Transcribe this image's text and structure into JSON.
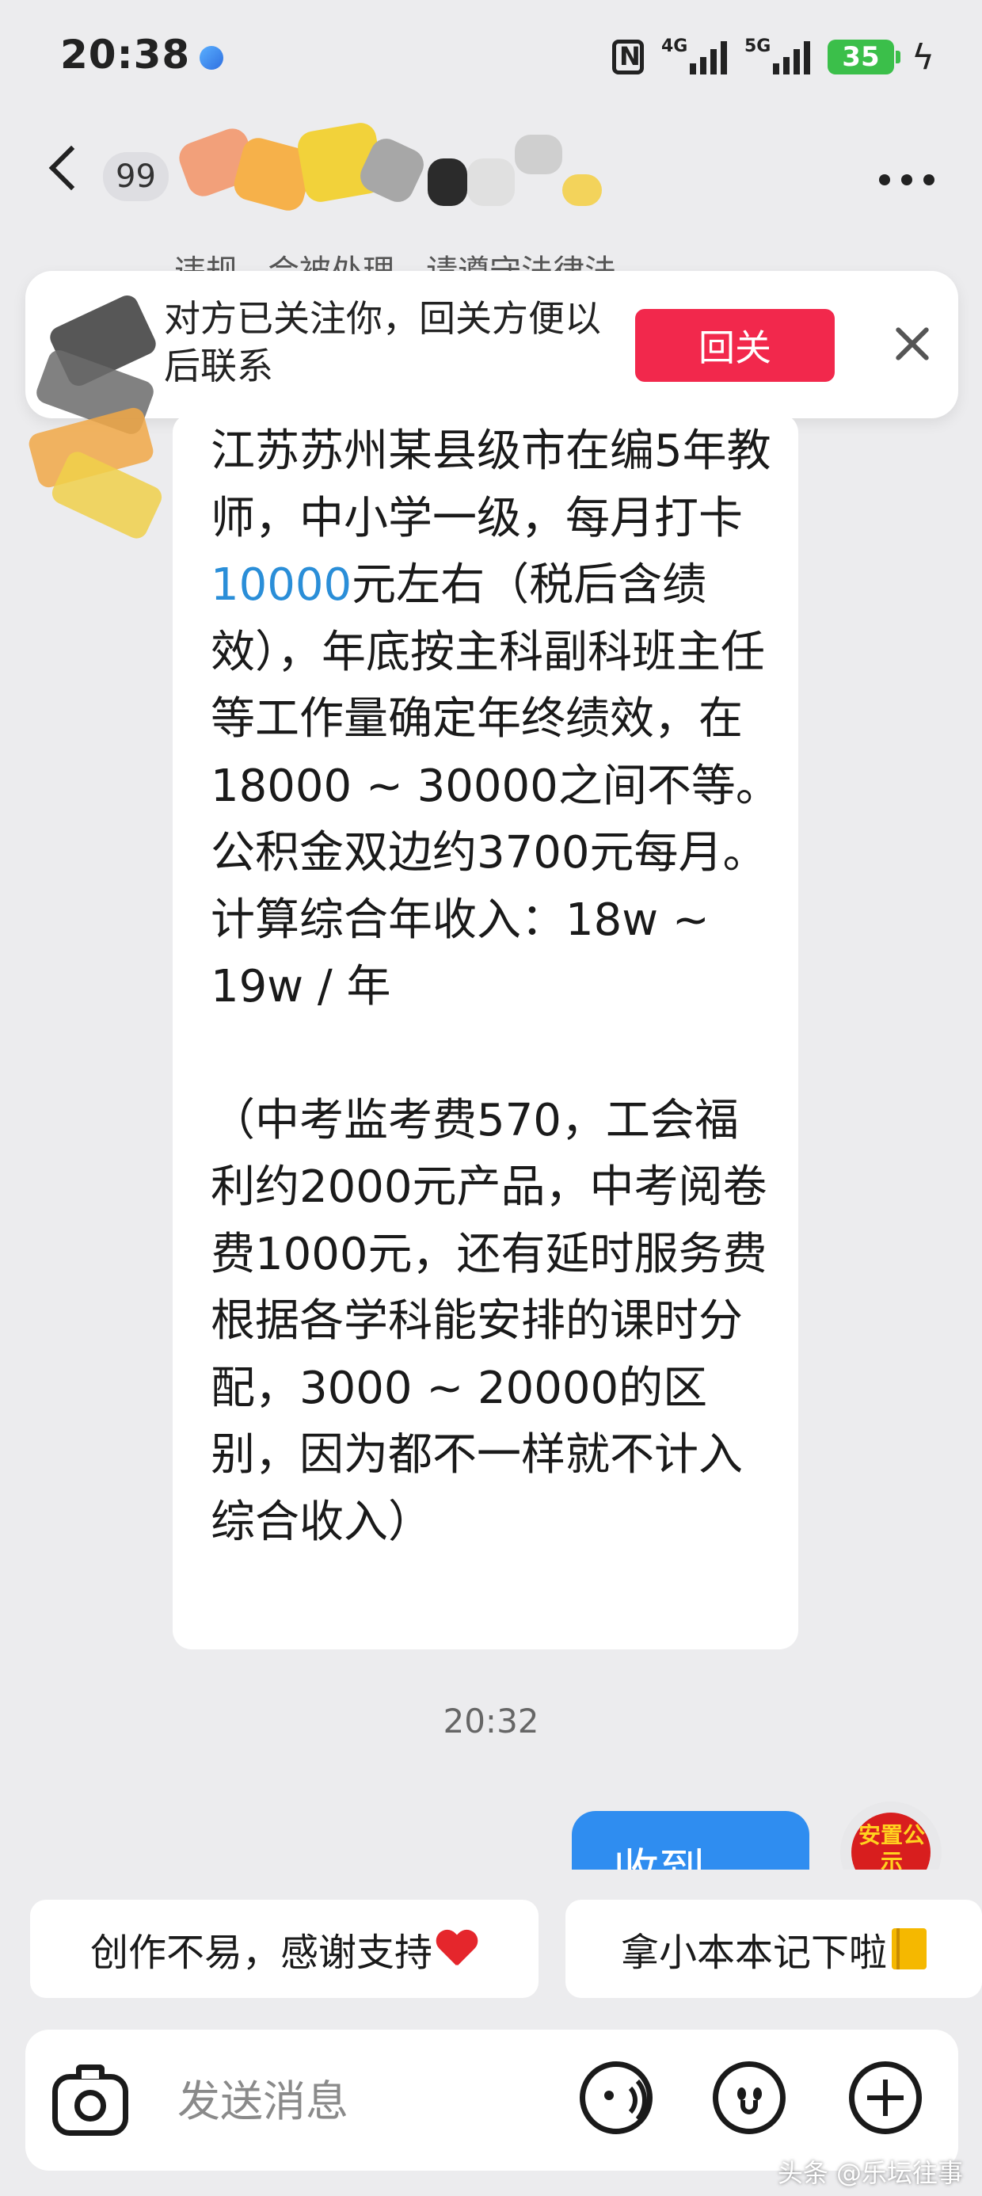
{
  "status_bar": {
    "time": "20:38",
    "network_1": "4G",
    "network_2": "5G",
    "battery": "35"
  },
  "header": {
    "unread_count": "99"
  },
  "partial_line": "违规...会被处理，请遵守法律法",
  "follow_banner": {
    "text": "对方已关注你，回关方便以后联系",
    "button_label": "回关"
  },
  "message": {
    "parts": [
      "江苏苏州某县级市在编5年教师，中小学一级，每月打卡",
      "10000",
      "元左右（税后含绩效），年底按主科副科班主任等工作量确定年终绩效，在18000 ~ 30000之间不等。公积金双边约3700元每月。",
      "计算综合年收入：18w ~ 19w / 年",
      "（中考监考费570，工会福利约2000元产品，中考阅卷费1000元，还有延时服务费根据各学科能安排的课时分配，3000 ~ 20000的区别，因为都不一样就不计入综合收入）"
    ],
    "highlight_color": "#2a8ed8"
  },
  "timestamp": "20:32",
  "my_reply": {
    "text": "收到"
  },
  "my_avatar": {
    "seal_text": "安置公示"
  },
  "quick_replies": [
    {
      "label": "创作不易，感谢支持",
      "icon": "heart-icon"
    },
    {
      "label": "拿小本本记下啦",
      "icon": "notebook-icon"
    }
  ],
  "input_bar": {
    "placeholder": "发送消息",
    "icons": [
      "camera-icon",
      "voice-icon",
      "emoji-icon",
      "plus-icon"
    ]
  },
  "watermark": "头条 @乐坛往事",
  "colors": {
    "accent_red": "#f2284c",
    "reply_blue": "#2f8df0",
    "background": "#ececee"
  }
}
